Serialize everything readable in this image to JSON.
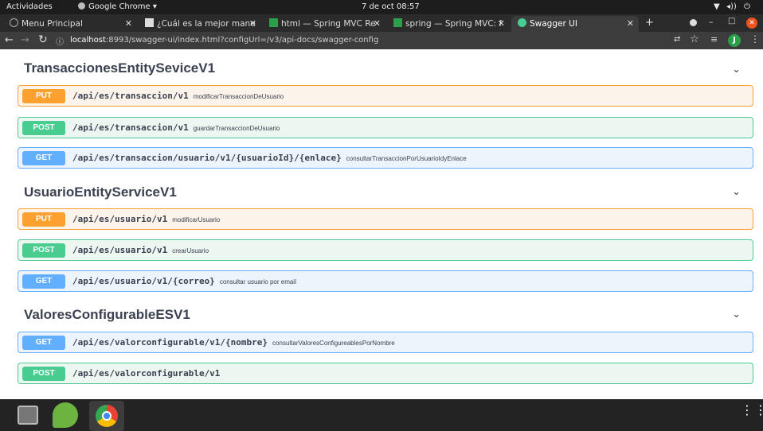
{
  "topbar": {
    "activities": "Actividades",
    "app": "Google Chrome ▾",
    "clock": "7 de oct  08:57"
  },
  "tabs": [
    {
      "label": "Menu Principal"
    },
    {
      "label": "¿Cuál es la mejor mane"
    },
    {
      "label": "html — Spring MVC Re"
    },
    {
      "label": "spring — Spring MVC: f"
    },
    {
      "label": "Swagger UI"
    }
  ],
  "url": {
    "host": "localhost",
    "rest": ":8993/swagger-ui/index.html?configUrl=/v3/api-docs/swagger-config"
  },
  "profile_initial": "J",
  "sections": [
    {
      "title": "TransaccionesEntitySeviceV1",
      "ops": [
        {
          "method": "PUT",
          "path": "/api/es/transaccion/v1",
          "desc": "modificarTransaccionDeUsuario"
        },
        {
          "method": "POST",
          "path": "/api/es/transaccion/v1",
          "desc": "guardarTransaccionDeUsuario"
        },
        {
          "method": "GET",
          "path": "/api/es/transaccion/usuario/v1/{usuarioId}/{enlace}",
          "desc": "consultarTransaccionPorUsuarioIdyEnlace"
        }
      ]
    },
    {
      "title": "UsuarioEntityServiceV1",
      "ops": [
        {
          "method": "PUT",
          "path": "/api/es/usuario/v1",
          "desc": "modificarUsuario"
        },
        {
          "method": "POST",
          "path": "/api/es/usuario/v1",
          "desc": "crearUsuario"
        },
        {
          "method": "GET",
          "path": "/api/es/usuario/v1/{correo}",
          "desc": "consultar usuario por email"
        }
      ]
    },
    {
      "title": "ValoresConfigurableESV1",
      "ops": [
        {
          "method": "GET",
          "path": "/api/es/valorconfigurable/v1/{nombre}",
          "desc": "consultarValoresConfigureablesPorNombre"
        },
        {
          "method": "POST",
          "path": "/api/es/valorconfigurable/v1",
          "desc": ""
        }
      ]
    }
  ],
  "colors": {
    "put": "#fca130",
    "post": "#49cc90",
    "get": "#61affe",
    "text": "#3b4151"
  }
}
